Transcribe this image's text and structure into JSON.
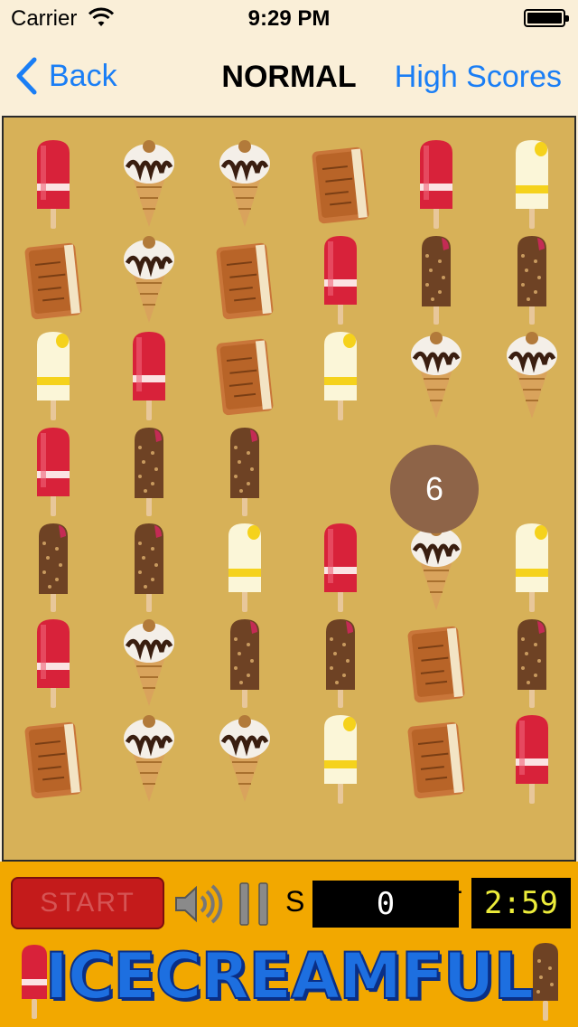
{
  "status_bar": {
    "carrier": "Carrier",
    "time": "9:29 PM"
  },
  "nav": {
    "back_label": "Back",
    "title": "NORMAL",
    "right_label": "High Scores"
  },
  "board": {
    "rows": [
      [
        "red-popsicle",
        "cone",
        "cone",
        "sandwich",
        "red-popsicle",
        "lemon-popsicle"
      ],
      [
        "sandwich",
        "cone",
        "sandwich",
        "red-popsicle",
        "choc-bar",
        "choc-bar"
      ],
      [
        "lemon-popsicle",
        "red-popsicle",
        "sandwich",
        "lemon-popsicle",
        "cone",
        "cone"
      ],
      [
        "red-popsicle",
        "choc-bar",
        "choc-bar",
        "",
        "",
        ""
      ],
      [
        "choc-bar",
        "choc-bar",
        "lemon-popsicle",
        "red-popsicle",
        "cone",
        "lemon-popsicle"
      ],
      [
        "red-popsicle",
        "cone",
        "choc-bar",
        "choc-bar",
        "sandwich",
        "choc-bar"
      ],
      [
        "sandwich",
        "cone",
        "cone",
        "lemon-popsicle",
        "sandwich",
        "red-popsicle"
      ]
    ],
    "badge_value": "6"
  },
  "controls": {
    "start_label": "START",
    "score_label": "S",
    "score_value": "0",
    "time_label": "T",
    "time_value": "2:59"
  },
  "banner": {
    "text": "ICECREAMFUL"
  },
  "colors": {
    "accent": "#1a7ef5",
    "board": "#d7b158",
    "bar": "#f2a800",
    "start": "#c41b1b",
    "timer": "#ecec3a"
  }
}
